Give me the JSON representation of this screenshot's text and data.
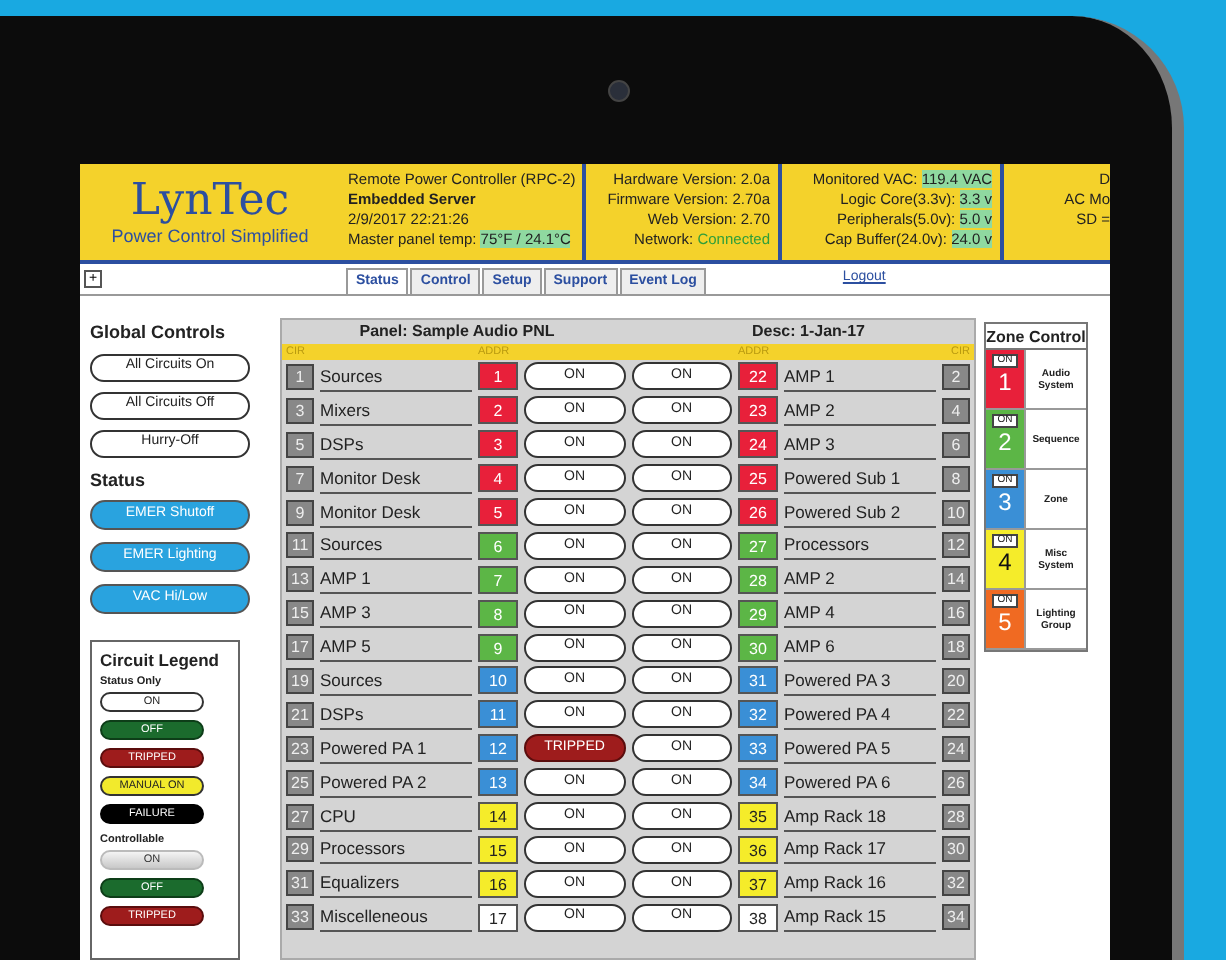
{
  "header": {
    "logo": "LynTec",
    "tagline": "Power Control Simplified",
    "info": [
      {
        "label": "Remote Power Controller (RPC-2)"
      },
      {
        "label": "Embedded Server",
        "bold": true
      },
      {
        "label": "2/9/2017 22:21:26"
      },
      {
        "label": "Master panel temp: ",
        "value": "75°F / 24.1°C",
        "kind": "highlight"
      }
    ],
    "versions": [
      {
        "label": "Hardware Version: ",
        "value": "2.0a"
      },
      {
        "label": "Firmware Version: ",
        "value": "2.70a"
      },
      {
        "label": "Web Version: ",
        "value": "2.70"
      },
      {
        "label": "Network: ",
        "value": "Connected",
        "kind": "good"
      }
    ],
    "power": [
      {
        "label": "Monitored VAC: ",
        "value": "119.4 VAC",
        "kind": "highlight"
      },
      {
        "label": "Logic Core(3.3v): ",
        "value": "3.3 v",
        "kind": "highlight"
      },
      {
        "label": "Peripherals(5.0v): ",
        "value": "5.0 v",
        "kind": "highlight"
      },
      {
        "label": "Cap Buffer(24.0v): ",
        "value": "24.0 v",
        "kind": "highlight"
      }
    ],
    "cut_column": [
      "D",
      "AC Mo",
      "SD ="
    ]
  },
  "expand_button": "+",
  "tabs": [
    {
      "label": "Status",
      "selected": true
    },
    {
      "label": "Control",
      "selected": false
    },
    {
      "label": "Setup",
      "selected": false
    },
    {
      "label": "Support",
      "selected": false
    },
    {
      "label": "Event Log",
      "selected": false
    }
  ],
  "logout": "Logout",
  "global_controls": {
    "title": "Global Controls",
    "buttons": [
      "All Circuits On",
      "All Circuits Off",
      "Hurry-Off"
    ]
  },
  "status": {
    "title": "Status",
    "buttons": [
      "EMER Shutoff",
      "EMER Lighting",
      "VAC Hi/Low"
    ]
  },
  "legend": {
    "title": "Circuit Legend",
    "groups": [
      {
        "title": "Status Only",
        "items": [
          {
            "label": "ON",
            "kind": "on"
          },
          {
            "label": "OFF",
            "kind": "off"
          },
          {
            "label": "TRIPPED",
            "kind": "tripped"
          },
          {
            "label": "MANUAL ON",
            "kind": "manual"
          },
          {
            "label": "FAILURE",
            "kind": "failure"
          }
        ]
      },
      {
        "title": "Controllable",
        "items": [
          {
            "label": "ON",
            "kind": "control"
          },
          {
            "label": "OFF",
            "kind": "off"
          },
          {
            "label": "TRIPPED",
            "kind": "tripped"
          }
        ]
      }
    ]
  },
  "panel": {
    "title": "Panel: Sample Audio PNL",
    "desc": "Desc: 1-Jan-17",
    "columns": [
      "CIR",
      "ADDR",
      "ADDR",
      "CIR"
    ],
    "rows": [
      {
        "left": {
          "cir": "1",
          "name": "Sources",
          "addr": "1",
          "color": "#e8203a",
          "label": "ON",
          "kind": "on"
        },
        "right": {
          "cir": "2",
          "name": "AMP 1",
          "addr": "22",
          "color": "#e8203a",
          "label": "ON",
          "kind": "on"
        }
      },
      {
        "left": {
          "cir": "3",
          "name": "Mixers",
          "addr": "2",
          "color": "#e8203a",
          "label": "ON",
          "kind": "on"
        },
        "right": {
          "cir": "4",
          "name": "AMP 2",
          "addr": "23",
          "color": "#e8203a",
          "label": "ON",
          "kind": "on"
        }
      },
      {
        "left": {
          "cir": "5",
          "name": "DSPs",
          "addr": "3",
          "color": "#e8203a",
          "label": "ON",
          "kind": "on"
        },
        "right": {
          "cir": "6",
          "name": "AMP 3",
          "addr": "24",
          "color": "#e8203a",
          "label": "ON",
          "kind": "on"
        }
      },
      {
        "left": {
          "cir": "7",
          "name": "Monitor Desk",
          "addr": "4",
          "color": "#e8203a",
          "label": "ON",
          "kind": "on"
        },
        "right": {
          "cir": "8",
          "name": "Powered Sub 1",
          "addr": "25",
          "color": "#e8203a",
          "label": "ON",
          "kind": "on"
        }
      },
      {
        "left": {
          "cir": "9",
          "name": "Monitor Desk",
          "addr": "5",
          "color": "#e8203a",
          "label": "ON",
          "kind": "on"
        },
        "right": {
          "cir": "10",
          "name": "Powered Sub 2",
          "addr": "26",
          "color": "#e8203a",
          "label": "ON",
          "kind": "on"
        }
      },
      {
        "left": {
          "cir": "11",
          "name": "Sources",
          "addr": "6",
          "color": "#5cb646",
          "label": "ON",
          "kind": "on"
        },
        "right": {
          "cir": "12",
          "name": "Processors",
          "addr": "27",
          "color": "#5cb646",
          "label": "ON",
          "kind": "on"
        }
      },
      {
        "left": {
          "cir": "13",
          "name": "AMP 1",
          "addr": "7",
          "color": "#5cb646",
          "label": "ON",
          "kind": "on"
        },
        "right": {
          "cir": "14",
          "name": "AMP 2",
          "addr": "28",
          "color": "#5cb646",
          "label": "ON",
          "kind": "on"
        }
      },
      {
        "left": {
          "cir": "15",
          "name": "AMP 3",
          "addr": "8",
          "color": "#5cb646",
          "label": "ON",
          "kind": "on"
        },
        "right": {
          "cir": "16",
          "name": "AMP 4",
          "addr": "29",
          "color": "#5cb646",
          "label": "ON",
          "kind": "on"
        }
      },
      {
        "left": {
          "cir": "17",
          "name": "AMP 5",
          "addr": "9",
          "color": "#5cb646",
          "label": "ON",
          "kind": "on"
        },
        "right": {
          "cir": "18",
          "name": "AMP 6",
          "addr": "30",
          "color": "#5cb646",
          "label": "ON",
          "kind": "on"
        }
      },
      {
        "left": {
          "cir": "19",
          "name": "Sources",
          "addr": "10",
          "color": "#3a8fd6",
          "label": "ON",
          "kind": "on"
        },
        "right": {
          "cir": "20",
          "name": "Powered PA 3",
          "addr": "31",
          "color": "#3a8fd6",
          "label": "ON",
          "kind": "on"
        }
      },
      {
        "left": {
          "cir": "21",
          "name": "DSPs",
          "addr": "11",
          "color": "#3a8fd6",
          "label": "ON",
          "kind": "on"
        },
        "right": {
          "cir": "22",
          "name": "Powered PA 4",
          "addr": "32",
          "color": "#3a8fd6",
          "label": "ON",
          "kind": "on"
        }
      },
      {
        "left": {
          "cir": "23",
          "name": "Powered PA 1",
          "addr": "12",
          "color": "#3a8fd6",
          "label": "TRIPPED",
          "kind": "tripped"
        },
        "right": {
          "cir": "24",
          "name": "Powered PA 5",
          "addr": "33",
          "color": "#3a8fd6",
          "label": "ON",
          "kind": "on"
        }
      },
      {
        "left": {
          "cir": "25",
          "name": "Powered PA 2",
          "addr": "13",
          "color": "#3a8fd6",
          "label": "ON",
          "kind": "on"
        },
        "right": {
          "cir": "26",
          "name": "Powered PA 6",
          "addr": "34",
          "color": "#3a8fd6",
          "label": "ON",
          "kind": "on"
        }
      },
      {
        "left": {
          "cir": "27",
          "name": "CPU",
          "addr": "14",
          "color": "#f5ec2a",
          "label": "ON",
          "kind": "on"
        },
        "right": {
          "cir": "28",
          "name": "Amp Rack 18",
          "addr": "35",
          "color": "#f5ec2a",
          "label": "ON",
          "kind": "on"
        }
      },
      {
        "left": {
          "cir": "29",
          "name": "Processors",
          "addr": "15",
          "color": "#f5ec2a",
          "label": "ON",
          "kind": "on"
        },
        "right": {
          "cir": "30",
          "name": "Amp Rack 17",
          "addr": "36",
          "color": "#f5ec2a",
          "label": "ON",
          "kind": "on"
        }
      },
      {
        "left": {
          "cir": "31",
          "name": "Equalizers",
          "addr": "16",
          "color": "#f5ec2a",
          "label": "ON",
          "kind": "on"
        },
        "right": {
          "cir": "32",
          "name": "Amp Rack 16",
          "addr": "37",
          "color": "#f5ec2a",
          "label": "ON",
          "kind": "on"
        }
      },
      {
        "left": {
          "cir": "33",
          "name": "Miscelleneous",
          "addr": "17",
          "color": "#ffffff",
          "label": "ON",
          "kind": "on"
        },
        "right": {
          "cir": "34",
          "name": "Amp Rack 15",
          "addr": "38",
          "color": "#ffffff",
          "label": "ON",
          "kind": "on"
        }
      }
    ]
  },
  "zone_control": {
    "title": "Zone Control",
    "zones": [
      {
        "number": "1",
        "label": "Audio System",
        "button": "ON",
        "color": "#e8203a"
      },
      {
        "number": "2",
        "label": "Sequence",
        "button": "ON",
        "color": "#5cb646"
      },
      {
        "number": "3",
        "label": "Zone",
        "button": "ON",
        "color": "#3a8fd6"
      },
      {
        "number": "4",
        "label": "Misc System",
        "button": "ON",
        "color": "#f5ec2a"
      },
      {
        "number": "5",
        "label": "Lighting Group",
        "button": "ON",
        "color": "#f06a22"
      }
    ]
  }
}
